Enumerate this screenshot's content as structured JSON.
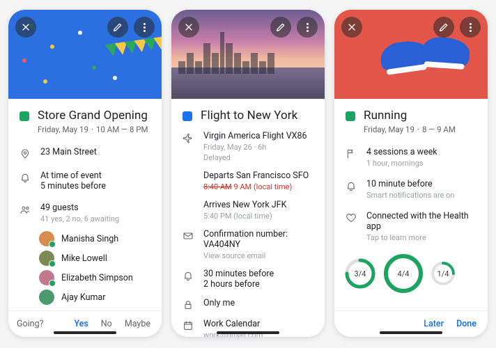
{
  "phone1": {
    "title": "Store Grand Opening",
    "date": "Friday, May 19",
    "time": "10 AM — 8 PM",
    "location": "23 Main Street",
    "reminder_line1": "At time of event",
    "reminder_line2": "5 minutes before",
    "guests_count": "49 guests",
    "guests_sub": "41 yes, 2 no, 6 awaiting",
    "guests": [
      {
        "name": "Manisha Singh",
        "color": "#d68e4e"
      },
      {
        "name": "Mike Lowell",
        "color": "#7b8a52"
      },
      {
        "name": "Elizabeth Simpson",
        "color": "#c07a8c"
      },
      {
        "name": "Ajay Kumar",
        "color": "#4a9a6e"
      }
    ],
    "rsvp_label": "Going?",
    "rsvp_yes": "Yes",
    "rsvp_no": "No",
    "rsvp_maybe": "Maybe"
  },
  "phone2": {
    "title": "Flight to New York",
    "flight_name": "Virgin America Flight VX86",
    "flight_date": "Friday, May 26 · 6h",
    "flight_status": "Delayed",
    "departs_label": "Departs San Francisco SFO",
    "departs_old": "8:40 AM",
    "departs_new": "9 AM (local time)",
    "arrives_label": "Arrives New York JFK",
    "arrives_time": "5:40 PM (local time)",
    "confirmation": "Confirmation number: VA404NY",
    "confirmation_sub": "View source email",
    "remind_line1": "30 minutes before",
    "remind_line2": "2 hours before",
    "visibility": "Only me",
    "calendar_name": "Work Calendar",
    "calendar_email": "work@gmail.com"
  },
  "phone3": {
    "title": "Running",
    "date": "Friday, May 19",
    "time": "8 — 9 AM",
    "schedule_line": "4 sessions a week",
    "schedule_sub": "1 hour, mornings",
    "remind_line": "10 minute before",
    "remind_sub": "Smart notifications are on",
    "health_line": "Connected with the Health app",
    "health_sub": "Tap to learn more",
    "rings": [
      {
        "label": "3/4",
        "pct": 75
      },
      {
        "label": "4/4",
        "pct": 100
      },
      {
        "label": "1/4",
        "pct": 25
      }
    ],
    "later": "Later",
    "done": "Done"
  }
}
